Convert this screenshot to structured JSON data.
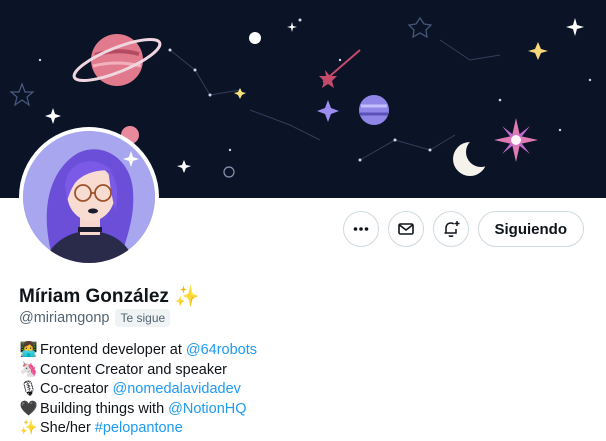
{
  "profile": {
    "name": "Míriam González",
    "name_emoji": "✨",
    "handle": "@miriamgonp",
    "follows_you": "Te sigue"
  },
  "actions": {
    "more_icon": "more-icon",
    "message_icon": "mail-icon",
    "notify_icon": "bell-plus-icon",
    "follow_label": "Siguiendo"
  },
  "bio": [
    {
      "emoji": "👩‍💻",
      "text": "Frontend developer at",
      "link": "@64robots"
    },
    {
      "emoji": "🦄",
      "text": "Content Creator and speaker",
      "link": ""
    },
    {
      "emoji": "🎙",
      "text": "Co-creator",
      "link": "@nomedalavidadev"
    },
    {
      "emoji": "🖤",
      "text": "Building things with",
      "link": "@NotionHQ"
    },
    {
      "emoji": "✨",
      "text": "She/her",
      "link": "#pelopantone"
    }
  ],
  "colors": {
    "banner": "#0b1426",
    "link": "#1d9bf0",
    "border": "#cfd9de",
    "muted": "#536471"
  }
}
